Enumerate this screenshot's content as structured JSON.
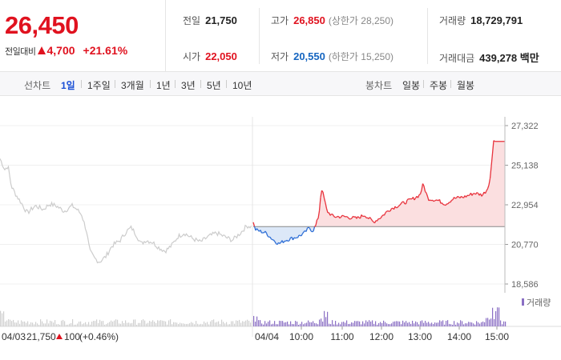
{
  "price": {
    "current": "26,450",
    "change_label": "전일대비",
    "change_value": "4,700",
    "change_pct": "+21.61%"
  },
  "stats": {
    "prev_close": {
      "label": "전일",
      "value": "21,750"
    },
    "high": {
      "label": "고가",
      "value": "26,850",
      "sub": "(상한가 28,250)"
    },
    "volume": {
      "label": "거래량",
      "value": "18,729,791"
    },
    "open": {
      "label": "시가",
      "value": "22,050"
    },
    "low": {
      "label": "저가",
      "value": "20,550",
      "sub": "(하한가 15,250)"
    },
    "amount": {
      "label": "거래대금",
      "value": "439,278 백만"
    }
  },
  "tabs": {
    "line_label": "선차트",
    "line_periods": [
      "1일",
      "1주일",
      "3개월",
      "1년",
      "3년",
      "5년",
      "10년"
    ],
    "candle_label": "봉차트",
    "candle_periods": [
      "일봉",
      "주봉",
      "월봉"
    ]
  },
  "chart_data": {
    "type": "line",
    "y_ticks": [
      "27,322",
      "25,138",
      "22,954",
      "20,770",
      "18,586"
    ],
    "ylim": [
      18586,
      27322
    ],
    "baseline": 21750,
    "prev_day": {
      "date": "04/03",
      "close": "21,750",
      "change": "100",
      "change_pct": "(+0.46%)"
    },
    "today": {
      "date": "04/04",
      "x_ticks": [
        "10:00",
        "11:00",
        "12:00",
        "13:00",
        "14:00",
        "15:00"
      ]
    },
    "volume_legend": "거래량",
    "colors": {
      "up": "#e8323c",
      "down": "#2f6fd6",
      "prev": "#cccccc",
      "volume": "#8a6fc4"
    }
  }
}
